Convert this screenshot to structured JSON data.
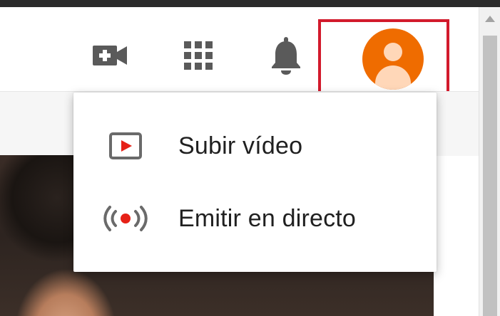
{
  "masthead": {
    "icons": {
      "create": "video-camera-plus-icon",
      "apps": "apps-grid-icon",
      "notifications": "bell-icon",
      "account": "account-avatar-icon"
    },
    "avatar_color": "#ef6c00",
    "highlight_color": "#d21a2c"
  },
  "create_menu": {
    "items": [
      {
        "label": "Subir vídeo",
        "icon": "upload-video-play-icon"
      },
      {
        "label": "Emitir en directo",
        "icon": "live-broadcast-icon"
      }
    ],
    "accent_color": "#e62117"
  }
}
